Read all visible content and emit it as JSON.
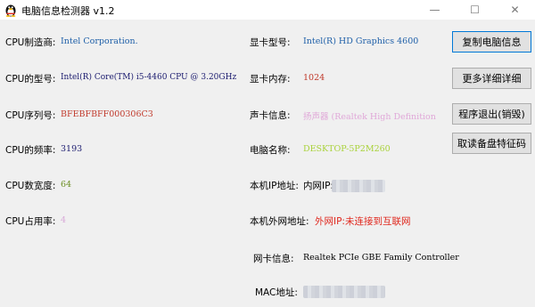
{
  "window": {
    "title": "电脑信息检测器 v1.2",
    "app_icon": "penguin-icon",
    "minimize_glyph": "—",
    "maximize_glyph": "☐",
    "close_glyph": "✕"
  },
  "left": {
    "cpu_maker_label": "CPU制造商:",
    "cpu_maker_value": "Intel Corporation.",
    "cpu_model_label": "CPU的型号:",
    "cpu_model_value": "Intel(R) Core(TM) i5-4460  CPU @ 3.20GHz",
    "cpu_serial_label": "CPU序列号:",
    "cpu_serial_value": "BFEBFBFF000306C3",
    "cpu_freq_label": "CPU的频率:",
    "cpu_freq_value": "3193",
    "cpu_width_label": "CPU数宽度:",
    "cpu_width_value": "64",
    "cpu_usage_label": "CPU占用率:",
    "cpu_usage_value": "4"
  },
  "right": {
    "gpu_model_label": "显卡型号:",
    "gpu_model_value": "Intel(R) HD Graphics 4600",
    "gpu_mem_label": "显卡内存:",
    "gpu_mem_value": "1024",
    "sound_label": "声卡信息:",
    "sound_value": "扬声器 (Realtek High Definition",
    "pc_name_label": "电脑名称:",
    "pc_name_value": "DESKTOP-5P2M260",
    "local_ip_label": "本机IP地址:",
    "local_ip_value": "内网IP:",
    "external_ip_label": "本机外网地址:",
    "external_ip_value": "外网IP:未连接到互联网",
    "nic_label": "网卡信息:",
    "nic_value": "Realtek PCIe GBE Family Controller",
    "mac_label": "MAC地址:"
  },
  "buttons": {
    "copy": "复制电脑信息",
    "more": "更多详细详细",
    "exit": "程序退出(销毁)",
    "read_disk": "取读备盘特征码"
  },
  "colors": {
    "blue_value": "#1e5fa8",
    "purple_value": "#8f3f8f",
    "red_value": "#c0392b",
    "green_value": "#6db33f",
    "pink_value": "#e0a8d8",
    "lime_value": "#a9d23a",
    "red_bright": "#e0281e",
    "navy_value": "#1a1a6e"
  }
}
